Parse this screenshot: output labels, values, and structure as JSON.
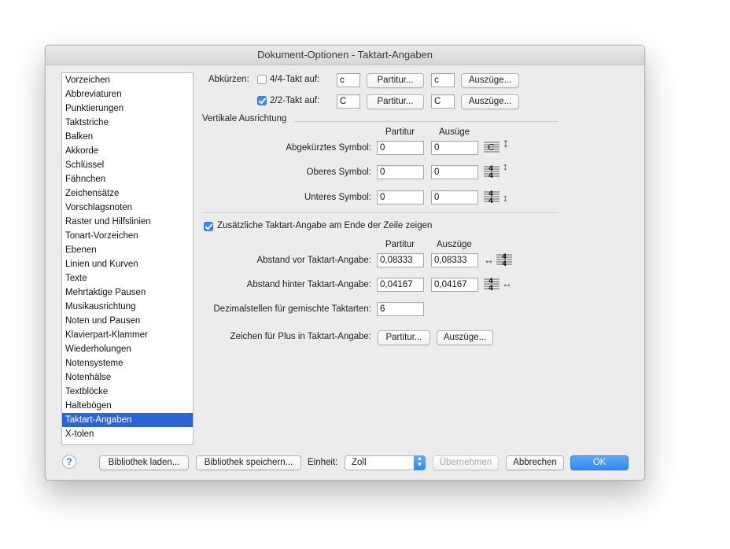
{
  "window": {
    "title": "Dokument-Optionen - Taktart-Angaben"
  },
  "sidebar": {
    "items": [
      "Vorzeichen",
      "Abbreviaturen",
      "Punktierungen",
      "Taktstriche",
      "Balken",
      "Akkorde",
      "Schlüssel",
      "Fähnchen",
      "Zeichensätze",
      "Vorschlagsnoten",
      "Raster und Hilfslinien",
      "Tonart-Vorzeichen",
      "Ebenen",
      "Linien und Kurven",
      "Texte",
      "Mehrtaktige Pausen",
      "Musikausrichtung",
      "Noten und Pausen",
      "Klavierpart-Klammer",
      "Wiederholungen",
      "Notensysteme",
      "Notenhälse",
      "Textblöcke",
      "Haltebögen",
      "Taktart-Angaben",
      "X-tolen"
    ],
    "selected": "Taktart-Angaben"
  },
  "abbreviate": {
    "label": "Abkürzen:",
    "rows": [
      {
        "label": "4/4-Takt auf:",
        "checked": false,
        "score_value": "c",
        "score_button": "Partitur...",
        "parts_value": "c",
        "parts_button": "Auszüge..."
      },
      {
        "label": "2/2-Takt auf:",
        "checked": true,
        "score_value": "C",
        "score_button": "Partitur...",
        "parts_value": "C",
        "parts_button": "Auszüge..."
      }
    ]
  },
  "vertical": {
    "heading": "Vertikale Ausrichtung",
    "col_score": "Partitur",
    "col_parts": "Ausüge",
    "rows": [
      {
        "label": "Abgekürztes Symbol:",
        "score": "0",
        "parts": "0",
        "icon": "abbreviated-symbol-icon"
      },
      {
        "label": "Oberes Symbol:",
        "score": "0",
        "parts": "0",
        "icon": "upper-symbol-icon"
      },
      {
        "label": "Unteres Symbol:",
        "score": "0",
        "parts": "0",
        "icon": "lower-symbol-icon"
      }
    ]
  },
  "extra": {
    "checkbox_label": "Zusätzliche Taktart-Angabe am Ende der Zeile zeigen",
    "checked": true,
    "col_score": "Partitur",
    "col_parts": "Auszüge",
    "rows": [
      {
        "label": "Abstand vor Taktart-Angabe:",
        "score": "0,08333",
        "parts": "0,08333"
      },
      {
        "label": "Abstand hinter Taktart-Angabe:",
        "score": "0,04167",
        "parts": "0,04167"
      }
    ],
    "decimal_label": "Dezimalstellen für gemischte Taktarten:",
    "decimal_value": "6",
    "plus_label": "Zeichen für Plus in Taktart-Angabe:",
    "plus_score_button": "Partitur...",
    "plus_parts_button": "Auszüge..."
  },
  "footer": {
    "help": "?",
    "load_library": "Bibliothek laden...",
    "save_library": "Bibliothek speichern...",
    "unit_label": "Einheit:",
    "unit_value": "Zoll",
    "apply": "Übernehmen",
    "cancel": "Abbrechen",
    "ok": "OK"
  },
  "colors": {
    "accent": "#2a66d8",
    "default_button": "#3b8cf3"
  }
}
